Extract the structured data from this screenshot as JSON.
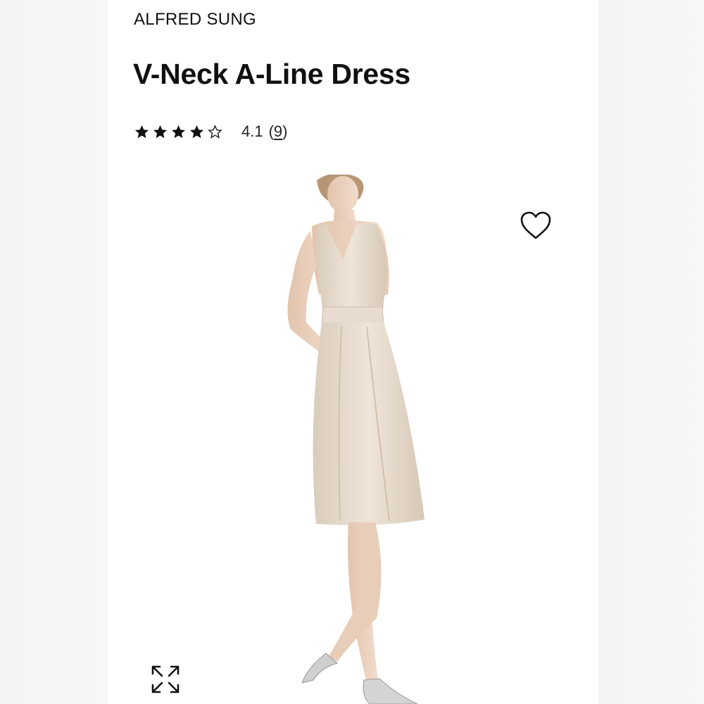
{
  "product": {
    "brand": "ALFRED SUNG",
    "title": "V-Neck A-Line Dress",
    "rating": {
      "value": "4.1",
      "count_open": "(",
      "count": "9",
      "count_close": ")",
      "stars_filled": 4,
      "stars_total": 5
    }
  },
  "icons": {
    "wishlist": "heart-outline-icon",
    "expand": "expand-arrows-icon"
  },
  "colors": {
    "text": "#111111",
    "dress": "#e8dccd",
    "background": "#ffffff"
  }
}
